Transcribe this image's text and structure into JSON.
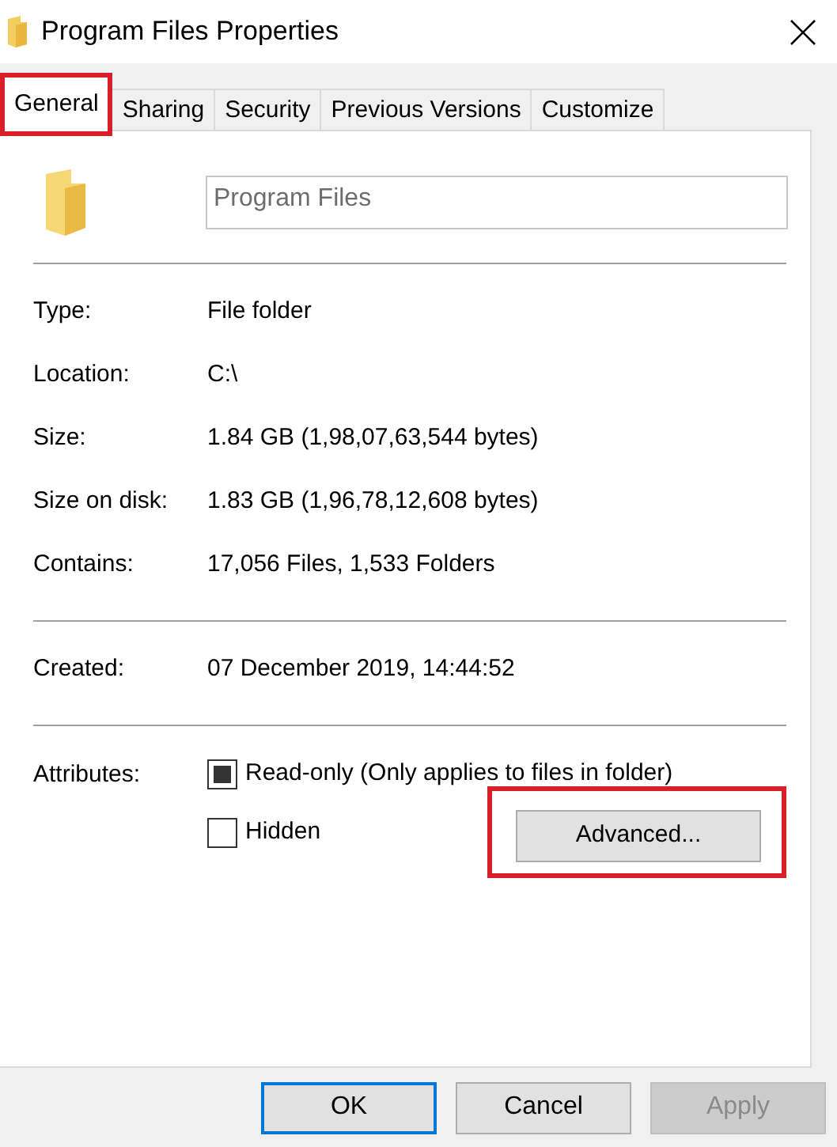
{
  "window": {
    "title": "Program Files Properties"
  },
  "tabs": [
    {
      "label": "General",
      "selected": true,
      "highlighted": true
    },
    {
      "label": "Sharing",
      "selected": false,
      "highlighted": false
    },
    {
      "label": "Security",
      "selected": false,
      "highlighted": false
    },
    {
      "label": "Previous Versions",
      "selected": false,
      "highlighted": false
    },
    {
      "label": "Customize",
      "selected": false,
      "highlighted": false
    }
  ],
  "name_field": {
    "value": "Program Files",
    "disabled": true
  },
  "sections": [
    {
      "rows": [
        {
          "label": "Type:",
          "value": "File folder"
        },
        {
          "label": "Location:",
          "value": "C:\\"
        },
        {
          "label": "Size:",
          "value": "1.84 GB (1,98,07,63,544 bytes)"
        },
        {
          "label": "Size on disk:",
          "value": "1.83 GB (1,96,78,12,608 bytes)"
        },
        {
          "label": "Contains:",
          "value": "17,056 Files, 1,533 Folders"
        }
      ]
    },
    {
      "rows": [
        {
          "label": "Created:",
          "value": "07 December 2019, 14:44:52"
        }
      ]
    }
  ],
  "attributes": {
    "label": "Attributes:",
    "options": [
      {
        "label": "Read-only (Only applies to files in folder)",
        "checked": false,
        "mixed": true
      },
      {
        "label": "Hidden",
        "checked": false,
        "mixed": false
      }
    ]
  },
  "advanced_button": {
    "label": "Advanced...",
    "highlighted": true
  },
  "buttons": [
    {
      "label": "OK",
      "default": true,
      "disabled": false
    },
    {
      "label": "Cancel",
      "default": false,
      "disabled": false
    },
    {
      "label": "Apply",
      "default": false,
      "disabled": true
    }
  ]
}
